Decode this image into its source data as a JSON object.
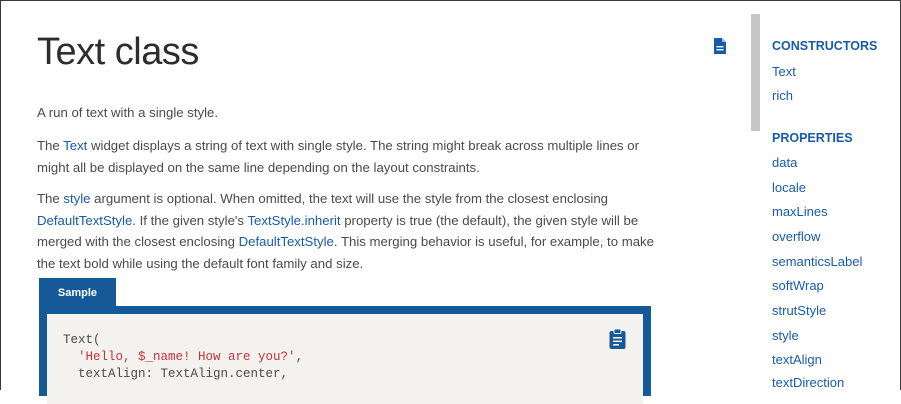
{
  "page": {
    "title": "Text class",
    "intro": "A run of text with a single style.",
    "p2": {
      "pre": "The ",
      "link1": "Text",
      "post": " widget displays a string of text with single style. The string might break across multiple lines or might all be displayed on the same line depending on the layout constraints."
    },
    "p3": {
      "t1": "The ",
      "link_style": "style",
      "t2": " argument is optional. When omitted, the text will use the style from the closest enclosing ",
      "link_dts1": "DefaultTextStyle",
      "t3": ". If the given style's ",
      "link_inherit": "TextStyle.inherit",
      "t4": " property is true (the default), the given style will be merged with the closest enclosing ",
      "link_dts2": "DefaultTextStyle",
      "t5": ". This merging behavior is useful, for example, to make the text bold while using the default font family and size."
    },
    "sample_tab": "Sample",
    "code": {
      "line1": "Text(",
      "line2_string": "'Hello, $_name! How are you?'",
      "line2_tail": ",",
      "line3": "textAlign: TextAlign.center,"
    }
  },
  "sidebar": {
    "constructors_heading": "CONSTRUCTORS",
    "constructors": [
      "Text",
      "rich"
    ],
    "properties_heading": "PROPERTIES",
    "properties": [
      "data",
      "locale",
      "maxLines",
      "overflow",
      "semanticsLabel",
      "softWrap",
      "strutStyle",
      "style",
      "textAlign",
      "textDirection"
    ]
  },
  "icons": {
    "doc": "document-icon",
    "copy": "clipboard-copy-icon"
  },
  "colors": {
    "link": "#175ca8",
    "sample_tab": "#155998",
    "code_bg": "#f3f2ef",
    "string": "#c4313a"
  }
}
